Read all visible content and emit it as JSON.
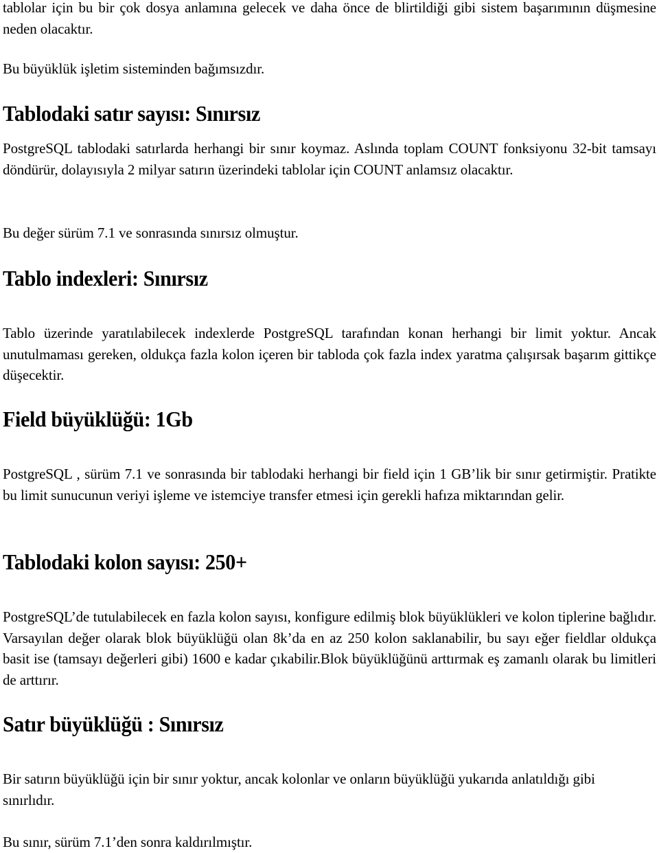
{
  "document": {
    "intro": {
      "paragraph_1": "tablolar için bu bir çok dosya anlamına gelecek ve daha önce de blirtildiği gibi sistem başarımının düşmesine neden olacaktır.",
      "paragraph_2": "Bu büyüklük işletim sisteminden bağımsızdır."
    },
    "sections": [
      {
        "heading": "Tablodaki satır sayısı: Sınırsız",
        "paragraphs": [
          "PostgreSQL tablodaki satırlarda herhangi bir sınır koymaz. Aslında toplam  COUNT fonksiyonu 32-bit tamsayı döndürür, dolayısıyla 2 milyar satırın üzerindeki tablolar için COUNT anlamsız olacaktır.",
          "Bu değer sürüm 7.1 ve sonrasında sınırsız olmuştur."
        ]
      },
      {
        "heading": "Tablo indexleri: Sınırsız",
        "paragraphs": [
          "Tablo üzerinde yaratılabilecek indexlerde PostgreSQL tarafından konan herhangi bir limit yoktur. Ancak unutulmaması gereken, oldukça fazla kolon içeren bir tabloda çok fazla index yaratma çalışırsak başarım gittikçe düşecektir."
        ]
      },
      {
        "heading": "Field büyüklüğü: 1Gb",
        "paragraphs": [
          "PostgreSQL , sürüm 7.1 ve sonrasında bir tablodaki herhangi bir field için 1 GB’lik bir sınır getirmiştir. Pratikte bu limit sunucunun veriyi işleme ve istemciye transfer etmesi için gerekli hafıza miktarından gelir."
        ]
      },
      {
        "heading": "Tablodaki kolon sayısı: 250+",
        "paragraphs": [
          "PostgreSQL’de tutulabilecek en fazla kolon sayısı, konfigure edilmiş blok büyüklükleri ve kolon tiplerine bağlıdır. Varsayılan değer olarak blok büyüklüğü olan 8k’da en az 250 kolon saklanabilir, bu sayı eğer fieldlar oldukça basit ise (tamsayı değerleri gibi) 1600 e kadar çıkabilir.Blok büyüklüğünü arttırmak eş zamanlı olarak bu limitleri de arttırır."
        ]
      },
      {
        "heading": "Satır büyüklüğü : Sınırsız",
        "paragraphs": [
          "Bir satırın büyüklüğü için bir sınır yoktur, ancak kolonlar ve onların büyüklüğü yukarıda anlatıldığı gibi sınırlıdır.",
          "Bu sınır, sürüm 7.1’den sonra kaldırılmıştır."
        ]
      }
    ]
  }
}
